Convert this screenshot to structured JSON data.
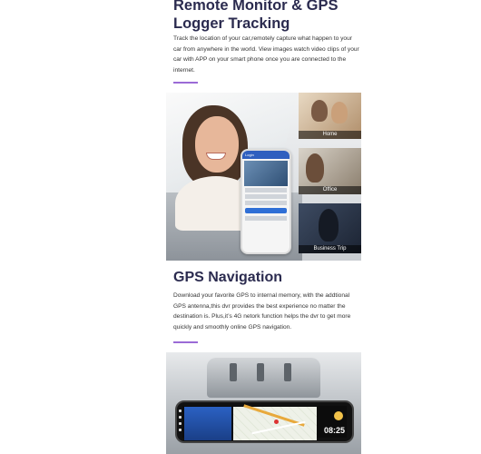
{
  "section1": {
    "title": "Remote Monitor & GPS Logger Tracking",
    "description": "Track the location of your car,remotely capture what happen to your car from anywhere in the world. View images watch video clips of your car with APP on your smart phone once you are connected to the internet."
  },
  "hero": {
    "phone_header": "Login",
    "thumbnails": [
      {
        "label": "Home"
      },
      {
        "label": "Office"
      },
      {
        "label": "Business Trip"
      }
    ]
  },
  "section2": {
    "title": "GPS Navigation",
    "description": "Download your favorite GPS to internal memory, with the addtional GPS antenna,this dvr provides the best experience no matter the destination is. Plus,it’s 4G netork function helps the dvr to get more quickly and smoothly online GPS navigation."
  },
  "dashcam": {
    "clock": "08:25"
  },
  "colors": {
    "title": "#2b2b4f",
    "accent": "#9b6bd6"
  }
}
